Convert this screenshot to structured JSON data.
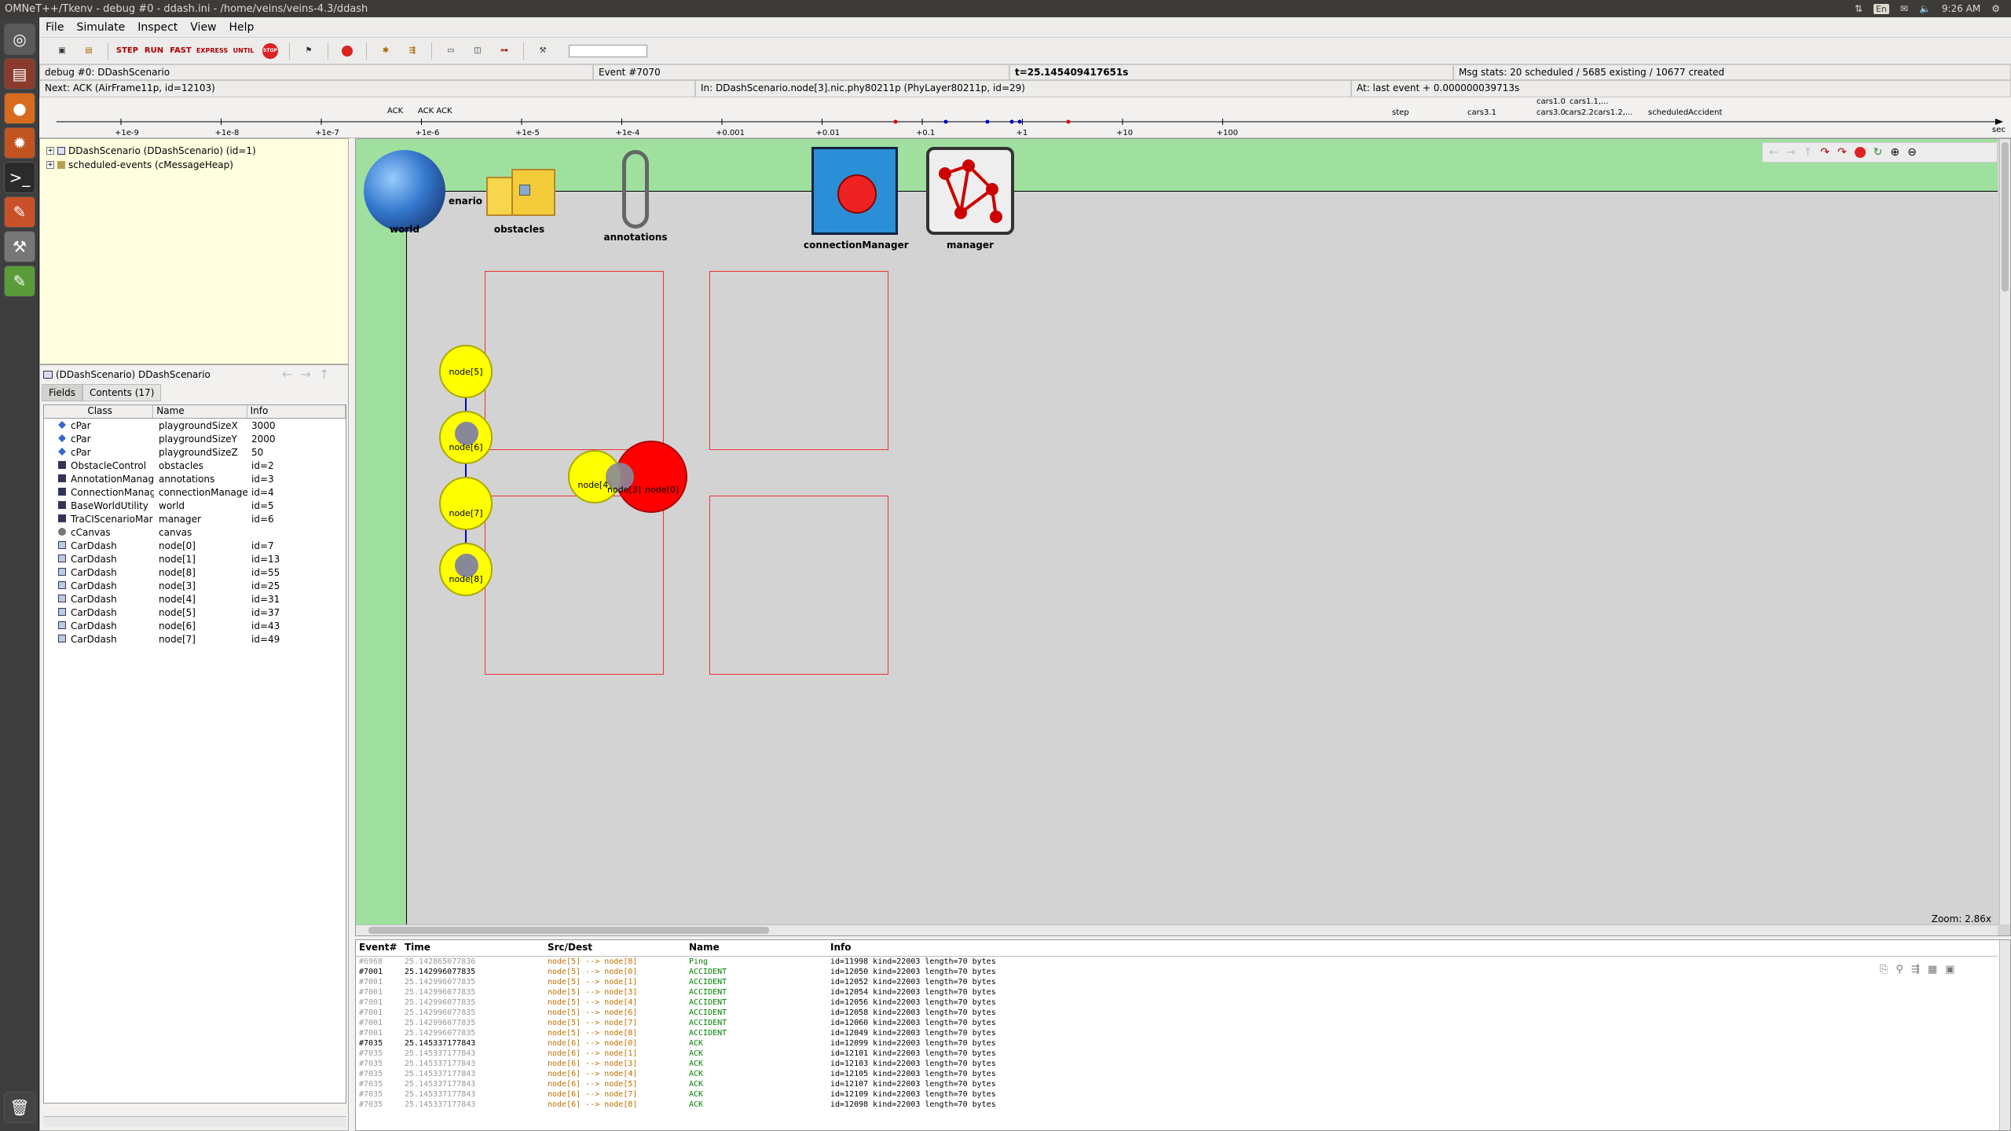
{
  "system": {
    "window_title": "OMNeT++/Tkenv - debug #0 - ddash.ini - /home/veins/veins-4.3/ddash",
    "lang": "En",
    "clock": "9:26 AM"
  },
  "menu": [
    "File",
    "Simulate",
    "Inspect",
    "View",
    "Help"
  ],
  "toolbar": {
    "buttons": [
      "new-network-icon",
      "load-ned-icon",
      "step-icon",
      "run-icon",
      "fast-run-icon",
      "express-run-icon",
      "run-until-icon",
      "stop-icon",
      "finish-icon",
      "record-icon",
      "object-tree-icon",
      "filter-icon",
      "tile-horizontal-icon",
      "tile-vertical-icon",
      "timeline-icon",
      "options-icon"
    ],
    "labels": {
      "step": "STEP",
      "run": "RUN",
      "fast": "FAST",
      "express": "EXPRESS",
      "until": "UNTIL",
      "stop": "STOP",
      "rec": "REC"
    }
  },
  "status": {
    "run_label": "debug #0: DDashScenario",
    "event": "Event #7070",
    "time": "t=25.145409417651s",
    "msg_stats": "Msg stats: 20 scheduled / 5685 existing / 10677 created",
    "next": "Next: ACK (AirFrame11p, id=12103)",
    "in": "In: DDashScenario.node[3].nic.phy80211p (PhyLayer80211p, id=29)",
    "at": "At: last event + 0.000000039713s"
  },
  "timeline": {
    "ticks": [
      "+1e-9",
      "+1e-8",
      "+1e-7",
      "+1e-6",
      "+1e-5",
      "+1e-4",
      "+0.001",
      "+0.01",
      "+0.1",
      "+1",
      "+10",
      "+100"
    ],
    "unit": "sec",
    "msgs": [
      "ACK",
      "ACK ACK",
      "step",
      "cars3.1",
      "cars1.0",
      "cars3.0",
      "cars1.1,...",
      "cars2.2cars1.2,...",
      "scheduledAccident"
    ]
  },
  "tree": {
    "items": [
      {
        "label": "DDashScenario (DDashScenario) (id=1)"
      },
      {
        "label": "scheduled-events (cMessageHeap)"
      }
    ]
  },
  "inspector": {
    "title": "(DDashScenario) DDashScenario",
    "tabs": [
      "Fields",
      "Contents (17)"
    ],
    "columns": [
      "Class",
      "Name",
      "Info"
    ],
    "rows": [
      {
        "cls": "cPar",
        "name": "playgroundSizeX",
        "info": "3000",
        "icon": "par"
      },
      {
        "cls": "cPar",
        "name": "playgroundSizeY",
        "info": "2000",
        "icon": "par"
      },
      {
        "cls": "cPar",
        "name": "playgroundSizeZ",
        "info": "50",
        "icon": "par"
      },
      {
        "cls": "ObstacleControl",
        "name": "obstacles",
        "info": "id=2",
        "icon": "mod"
      },
      {
        "cls": "AnnotationManag",
        "name": "annotations",
        "info": "id=3",
        "icon": "mod"
      },
      {
        "cls": "ConnectionManag",
        "name": "connectionManager",
        "info": "id=4",
        "icon": "mod"
      },
      {
        "cls": "BaseWorldUtility",
        "name": "world",
        "info": "id=5",
        "icon": "mod"
      },
      {
        "cls": "TraCIScenarioMar",
        "name": "manager",
        "info": "id=6",
        "icon": "mod"
      },
      {
        "cls": "cCanvas",
        "name": "canvas",
        "info": "",
        "icon": "canvas"
      },
      {
        "cls": "CarDdash",
        "name": "node[0]",
        "info": "id=7",
        "icon": "cmod"
      },
      {
        "cls": "CarDdash",
        "name": "node[1]",
        "info": "id=13",
        "icon": "cmod"
      },
      {
        "cls": "CarDdash",
        "name": "node[8]",
        "info": "id=55",
        "icon": "cmod"
      },
      {
        "cls": "CarDdash",
        "name": "node[3]",
        "info": "id=25",
        "icon": "cmod"
      },
      {
        "cls": "CarDdash",
        "name": "node[4]",
        "info": "id=31",
        "icon": "cmod"
      },
      {
        "cls": "CarDdash",
        "name": "node[5]",
        "info": "id=37",
        "icon": "cmod"
      },
      {
        "cls": "CarDdash",
        "name": "node[6]",
        "info": "id=43",
        "icon": "cmod"
      },
      {
        "cls": "CarDdash",
        "name": "node[7]",
        "info": "id=49",
        "icon": "cmod"
      }
    ]
  },
  "canvas": {
    "modules": [
      {
        "name": "world"
      },
      {
        "name": "obstacles"
      },
      {
        "name": "annotations"
      },
      {
        "name": "connectionManager"
      },
      {
        "name": "manager"
      }
    ],
    "scenario_label_fragment": "enario",
    "nodes": [
      "node[5]",
      "node[6]",
      "node[7]",
      "node[8]",
      "node[4]",
      "node[3]",
      "node[0]"
    ],
    "zoom": "Zoom: 2.86x"
  },
  "log": {
    "columns": [
      "Event#",
      "Time",
      "Src/Dest",
      "Name",
      "Info"
    ],
    "rows": [
      {
        "ev": "#6968",
        "t": "25.142865077836",
        "sd": "node[5] --> node[8]",
        "name": "Ping",
        "info": "id=11998  kind=22003  length=70 bytes",
        "dim": true
      },
      {
        "ev": "#7001",
        "t": "25.142996077835",
        "sd": "node[5] --> node[0]",
        "name": "ACCIDENT",
        "info": "id=12050  kind=22003  length=70 bytes",
        "dim": false
      },
      {
        "ev": "#7001",
        "t": "25.142996077835",
        "sd": "node[5] --> node[1]",
        "name": "ACCIDENT",
        "info": "id=12052  kind=22003  length=70 bytes",
        "dim": true
      },
      {
        "ev": "#7001",
        "t": "25.142996077835",
        "sd": "node[5] --> node[3]",
        "name": "ACCIDENT",
        "info": "id=12054  kind=22003  length=70 bytes",
        "dim": true
      },
      {
        "ev": "#7001",
        "t": "25.142996077835",
        "sd": "node[5] --> node[4]",
        "name": "ACCIDENT",
        "info": "id=12056  kind=22003  length=70 bytes",
        "dim": true
      },
      {
        "ev": "#7001",
        "t": "25.142996077835",
        "sd": "node[5] --> node[6]",
        "name": "ACCIDENT",
        "info": "id=12058  kind=22003  length=70 bytes",
        "dim": true
      },
      {
        "ev": "#7001",
        "t": "25.142996077835",
        "sd": "node[5] --> node[7]",
        "name": "ACCIDENT",
        "info": "id=12060  kind=22003  length=70 bytes",
        "dim": true
      },
      {
        "ev": "#7001",
        "t": "25.142996077835",
        "sd": "node[5] --> node[8]",
        "name": "ACCIDENT",
        "info": "id=12049  kind=22003  length=70 bytes",
        "dim": true
      },
      {
        "ev": "#7035",
        "t": "25.145337177843",
        "sd": "node[6] --> node[0]",
        "name": "ACK",
        "info": "id=12099  kind=22003  length=70 bytes",
        "dim": false
      },
      {
        "ev": "#7035",
        "t": "25.145337177843",
        "sd": "node[6] --> node[1]",
        "name": "ACK",
        "info": "id=12101  kind=22003  length=70 bytes",
        "dim": true
      },
      {
        "ev": "#7035",
        "t": "25.145337177843",
        "sd": "node[6] --> node[3]",
        "name": "ACK",
        "info": "id=12103  kind=22003  length=70 bytes",
        "dim": true
      },
      {
        "ev": "#7035",
        "t": "25.145337177843",
        "sd": "node[6] --> node[4]",
        "name": "ACK",
        "info": "id=12105  kind=22003  length=70 bytes",
        "dim": true
      },
      {
        "ev": "#7035",
        "t": "25.145337177843",
        "sd": "node[6] --> node[5]",
        "name": "ACK",
        "info": "id=12107  kind=22003  length=70 bytes",
        "dim": true
      },
      {
        "ev": "#7035",
        "t": "25.145337177843",
        "sd": "node[6] --> node[7]",
        "name": "ACK",
        "info": "id=12109  kind=22003  length=70 bytes",
        "dim": true
      },
      {
        "ev": "#7035",
        "t": "25.145337177843",
        "sd": "node[6] --> node[8]",
        "name": "ACK",
        "info": "id=12098  kind=22003  length=70 bytes",
        "dim": true
      }
    ]
  },
  "colors": {
    "green": "#9fe09f",
    "tree_bg": "#ffffe0",
    "node_yellow": "#ffff00",
    "accident_red": "#ff0000",
    "log_green": "#008000",
    "log_orange": "#c07000"
  }
}
